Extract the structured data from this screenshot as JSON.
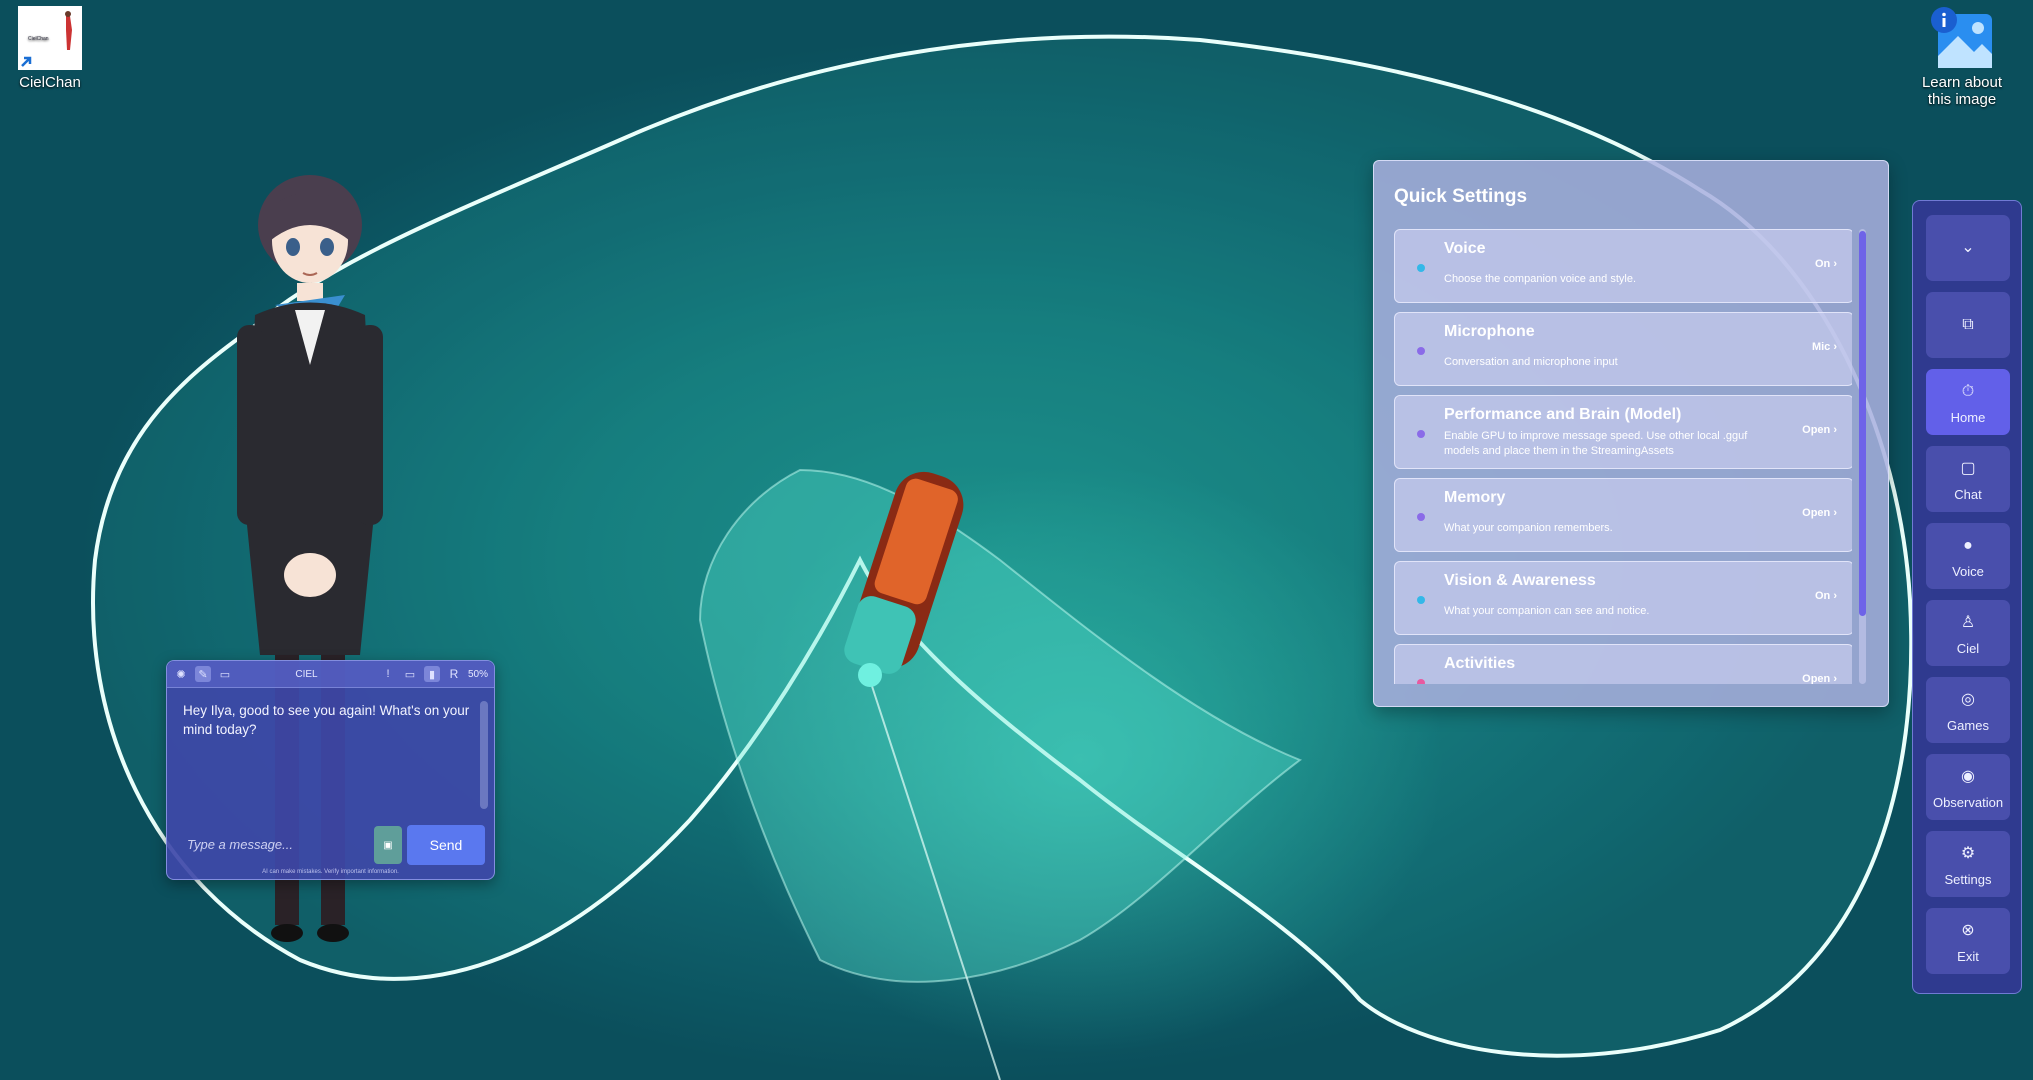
{
  "desktop": {
    "icons": [
      {
        "label": "CielChan"
      },
      {
        "label": "Learn about this image"
      }
    ]
  },
  "chat_window": {
    "toolbar": {
      "title": "CIEL",
      "badge": "R",
      "percent": "50%"
    },
    "message": "Hey Ilya, good to see you again! What's on your mind today?",
    "input_placeholder": "Type a message...",
    "send_label": "Send",
    "disclaimer": "AI can make mistakes. Verify important information."
  },
  "quick_settings": {
    "title": "Quick Settings",
    "items": [
      {
        "name": "Voice",
        "description": "Choose the companion voice and style.",
        "state": "On ›",
        "dot_color": "#33b8e8"
      },
      {
        "name": "Microphone",
        "description": "Conversation and microphone input",
        "state": "Mic ›",
        "dot_color": "#8a6be8"
      },
      {
        "name": "Performance and Brain (Model)",
        "description": "Enable GPU to improve message speed. Use other local .gguf models and place them in the StreamingAssets",
        "state": "Open ›",
        "dot_color": "#8a6be8"
      },
      {
        "name": "Memory",
        "description": "What your companion remembers.",
        "state": "Open ›",
        "dot_color": "#8a6be8"
      },
      {
        "name": "Vision & Awareness",
        "description": "What your companion can see and notice.",
        "state": "On ›",
        "dot_color": "#33b8e8"
      },
      {
        "name": "Activities",
        "description": "",
        "state": "Open ›",
        "dot_color": "#e85aa0"
      }
    ]
  },
  "sidebar": {
    "items": [
      {
        "label": "",
        "icon": "chevron-down-icon"
      },
      {
        "label": "",
        "icon": "external-link-icon"
      },
      {
        "label": "Home",
        "icon": "home-icon",
        "active": true
      },
      {
        "label": "Chat",
        "icon": "chat-icon"
      },
      {
        "label": "Voice",
        "icon": "microphone-icon"
      },
      {
        "label": "Ciel",
        "icon": "ciel-icon"
      },
      {
        "label": "Games",
        "icon": "gamepad-icon"
      },
      {
        "label": "Observation",
        "icon": "eye-icon"
      },
      {
        "label": "Settings",
        "icon": "gear-icon"
      },
      {
        "label": "Exit",
        "icon": "close-circle-icon"
      }
    ]
  }
}
